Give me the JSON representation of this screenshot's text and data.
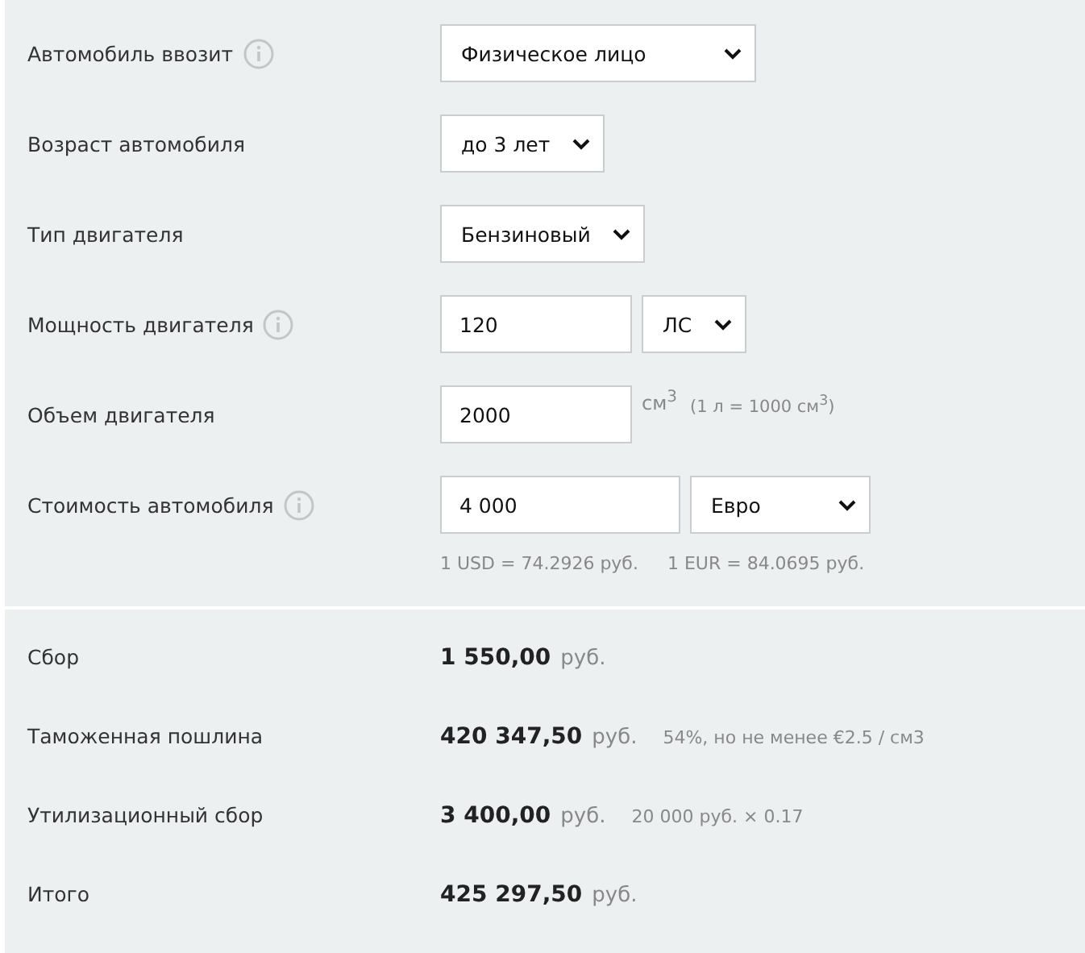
{
  "form": {
    "rows": [
      {
        "label": "Автомобиль ввозит",
        "info": true,
        "controls": [
          {
            "kind": "select",
            "value": "Физическое лицо"
          }
        ]
      },
      {
        "label": "Возраст автомобиля",
        "info": false,
        "controls": [
          {
            "kind": "select",
            "value": "до 3 лет"
          }
        ]
      },
      {
        "label": "Тип двигателя",
        "info": false,
        "controls": [
          {
            "kind": "select",
            "value": "Бензиновый"
          }
        ]
      },
      {
        "label": "Мощность двигателя",
        "info": true,
        "controls": [
          {
            "kind": "input",
            "value": "120"
          },
          {
            "kind": "select",
            "value": "ЛС"
          }
        ]
      },
      {
        "label": "Объем двигателя",
        "info": false,
        "controls": [
          {
            "kind": "input",
            "value": "2000"
          },
          {
            "kind": "unit",
            "value": "см$^{3}$"
          },
          {
            "kind": "note",
            "value": "(1 л = 1000 см$^{3}$)"
          }
        ]
      },
      {
        "label": "Стоимость автомобиля",
        "info": true,
        "controls": [
          {
            "kind": "input",
            "value": "4 000"
          },
          {
            "kind": "select",
            "value": "Евро"
          }
        ]
      }
    ],
    "rates": [
      "1 USD = 74.2926 руб.",
      "1 EUR = 84.0695 руб."
    ]
  },
  "results": [
    {
      "label": "Сбор",
      "amount": "1 550,00",
      "currency": "руб."
    },
    {
      "label": "Таможенная пошлина",
      "amount": "420 347,50",
      "currency": "руб.",
      "note": "54%, но не менее €2.5 / см3"
    },
    {
      "label": "Утилизационный сбор",
      "amount": "3 400,00",
      "currency": "руб.",
      "note": "20 000 руб. × 0.17"
    },
    {
      "label": "Итого",
      "amount": "425 297,50",
      "currency": "руб."
    }
  ]
}
